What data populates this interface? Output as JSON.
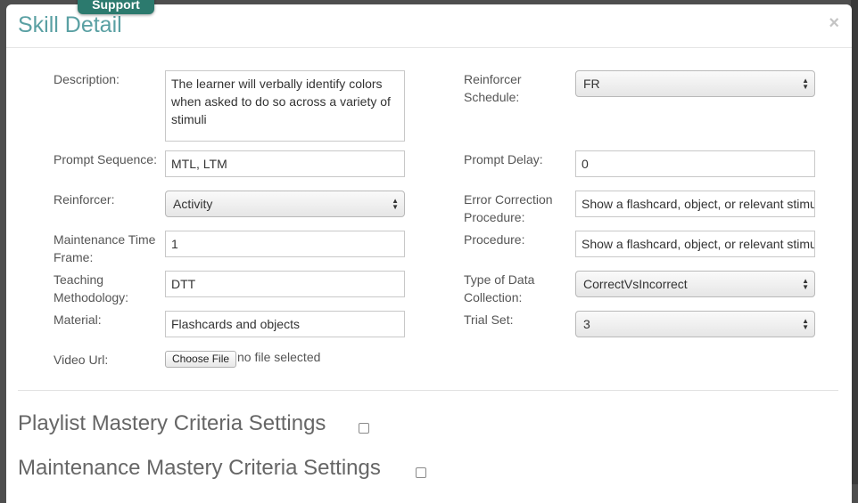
{
  "support_tab": {
    "label": "Support"
  },
  "modal": {
    "title": "Skill Detail",
    "close_glyph": "×"
  },
  "left": {
    "description": {
      "label": "Description:",
      "value": "The learner will verbally identify colors when asked to do so across a variety of stimuli"
    },
    "prompt_sequence": {
      "label": "Prompt Sequence:",
      "value": "MTL, LTM"
    },
    "reinforcer": {
      "label": "Reinforcer:",
      "value": "Activity"
    },
    "maintenance_time_frame": {
      "label": "Maintenance Time Frame:",
      "value": "1"
    },
    "teaching_methodology": {
      "label": "Teaching Methodology:",
      "value": "DTT"
    },
    "material": {
      "label": "Material:",
      "value": "Flashcards and objects"
    },
    "video_url": {
      "label": "Video Url:",
      "button": "Choose File",
      "status": "no file selected"
    }
  },
  "right": {
    "reinforcer_schedule": {
      "label": "Reinforcer Schedule:",
      "value": "FR"
    },
    "prompt_delay": {
      "label": "Prompt Delay:",
      "value": "0"
    },
    "error_correction": {
      "label": "Error Correction Procedure:",
      "value": "Show a flashcard, object, or relevant stimulus"
    },
    "procedure": {
      "label": "Procedure:",
      "value": "Show a flashcard, object, or relevant stimulus"
    },
    "data_collection": {
      "label": "Type of Data Collection:",
      "value": "CorrectVsIncorrect"
    },
    "trial_set": {
      "label": "Trial Set:",
      "value": "3"
    }
  },
  "sections": {
    "playlist_mastery": "Playlist Mastery Criteria Settings",
    "maintenance_mastery": "Maintenance Mastery Criteria Settings"
  },
  "colors": {
    "title": "#5aa0a3",
    "support_tab": "#2c7a6e"
  }
}
